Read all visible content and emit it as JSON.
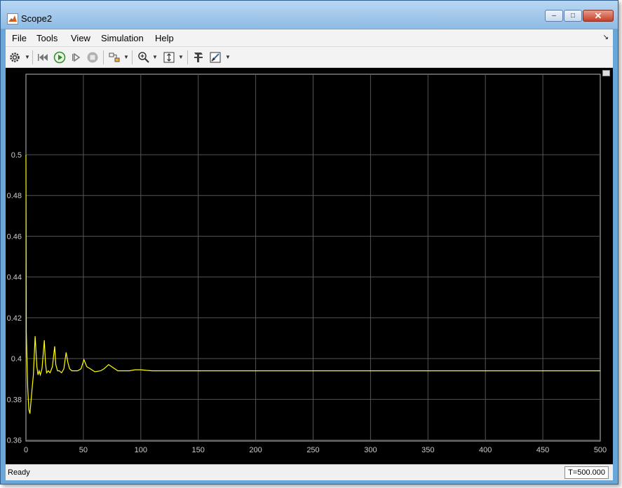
{
  "window": {
    "title": "Scope2"
  },
  "window_buttons": {
    "minimize": "‒",
    "maximize": "□",
    "close": "✕"
  },
  "menu": [
    "File",
    "Tools",
    "View",
    "Simulation",
    "Help"
  ],
  "menu_overflow": "↘",
  "toolbar": {
    "icons": [
      "gear-icon",
      "step-back-icon",
      "run-icon",
      "step-forward-icon",
      "stop-icon",
      "highlight-block-icon",
      "zoom-in-icon",
      "scale-axes-icon",
      "style-icon",
      "cursor-measure-icon"
    ]
  },
  "colors": {
    "plot_bg": "#000000",
    "trace": "#ffff00",
    "grid": "#555555",
    "tick_text": "#cccccc"
  },
  "chart_data": {
    "type": "line",
    "title": "",
    "xlabel": "",
    "ylabel": "",
    "xlim": [
      0,
      500
    ],
    "ylim": [
      0.3595,
      0.5395
    ],
    "xticks": [
      0,
      50,
      100,
      150,
      200,
      250,
      300,
      350,
      400,
      450,
      500
    ],
    "yticks": [
      0.36,
      0.38,
      0.4,
      0.42,
      0.44,
      0.46,
      0.48,
      0.5
    ],
    "ytick_labels": [
      "0.36",
      "0.38",
      "0.4",
      "0.42",
      "0.44",
      "0.46",
      "0.48",
      "0.5"
    ],
    "grid": true,
    "series": [
      {
        "x": [
          0,
          0.3,
          0.8,
          1.5,
          2.5,
          3.5,
          5,
          6.5,
          8,
          9.5,
          10.5,
          11.5,
          12.5,
          14,
          16,
          17,
          18,
          19.5,
          21,
          23,
          25,
          26,
          27.5,
          29,
          31,
          33,
          35,
          36.5,
          38,
          40,
          42,
          45,
          48,
          50.5,
          53,
          56,
          60,
          65,
          68,
          72,
          76,
          80,
          85,
          90,
          95,
          100,
          105,
          110,
          115,
          120,
          130,
          140,
          150,
          200,
          300,
          400,
          500
        ],
        "y": [
          0.5,
          0.413,
          0.402,
          0.386,
          0.375,
          0.373,
          0.383,
          0.392,
          0.411,
          0.396,
          0.392,
          0.394,
          0.392,
          0.395,
          0.409,
          0.398,
          0.393,
          0.394,
          0.393,
          0.396,
          0.406,
          0.397,
          0.394,
          0.394,
          0.393,
          0.395,
          0.403,
          0.398,
          0.395,
          0.394,
          0.394,
          0.394,
          0.395,
          0.3995,
          0.396,
          0.395,
          0.3935,
          0.394,
          0.395,
          0.397,
          0.3955,
          0.394,
          0.394,
          0.394,
          0.3945,
          0.3945,
          0.3942,
          0.394,
          0.394,
          0.394,
          0.394,
          0.394,
          0.394,
          0.394,
          0.394,
          0.394,
          0.394
        ]
      }
    ]
  },
  "status": {
    "text": "Ready",
    "time": "T=500.000"
  }
}
